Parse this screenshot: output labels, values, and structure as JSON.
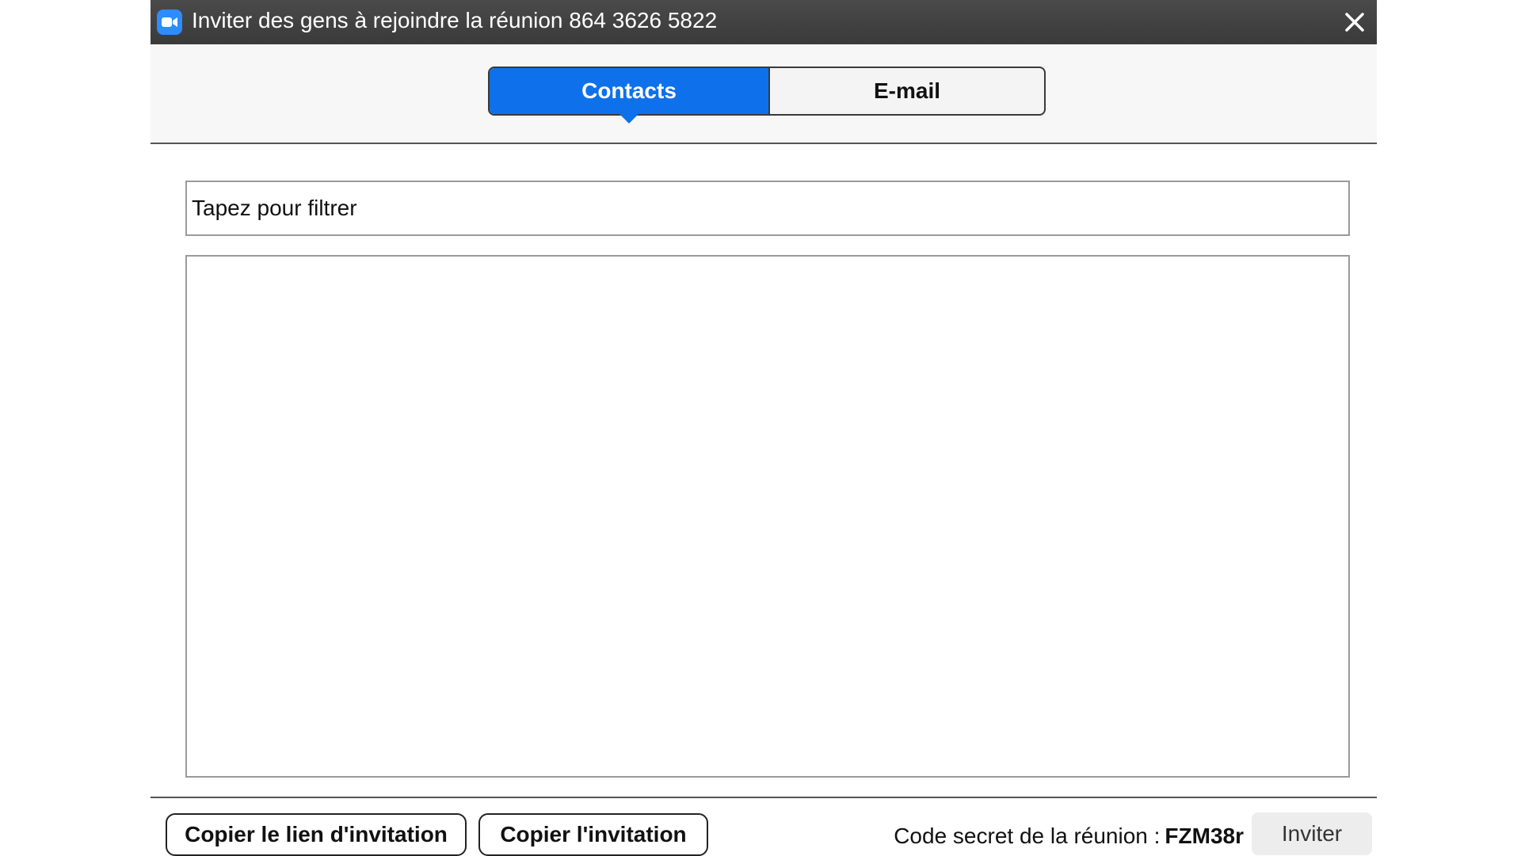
{
  "window": {
    "title": "Inviter des gens à rejoindre la réunion 864 3626 5822"
  },
  "tabs": [
    {
      "label": "Contacts",
      "active": true
    },
    {
      "label": "E-mail",
      "active": false
    }
  ],
  "filter": {
    "placeholder": "Tapez pour filtrer",
    "value": ""
  },
  "footer": {
    "copy_link_label": "Copier le lien d'invitation",
    "copy_invitation_label": "Copier l'invitation",
    "passcode_label": "Code secret de la réunion :",
    "passcode_value": "FZM38r",
    "invite_label": "Inviter"
  },
  "colors": {
    "active_tab": "#0e71eb",
    "titlebar": "#3e3e3e",
    "app_icon": "#2d8cff"
  },
  "icons": {
    "app": "zoom-camera-icon",
    "close": "close-icon"
  }
}
